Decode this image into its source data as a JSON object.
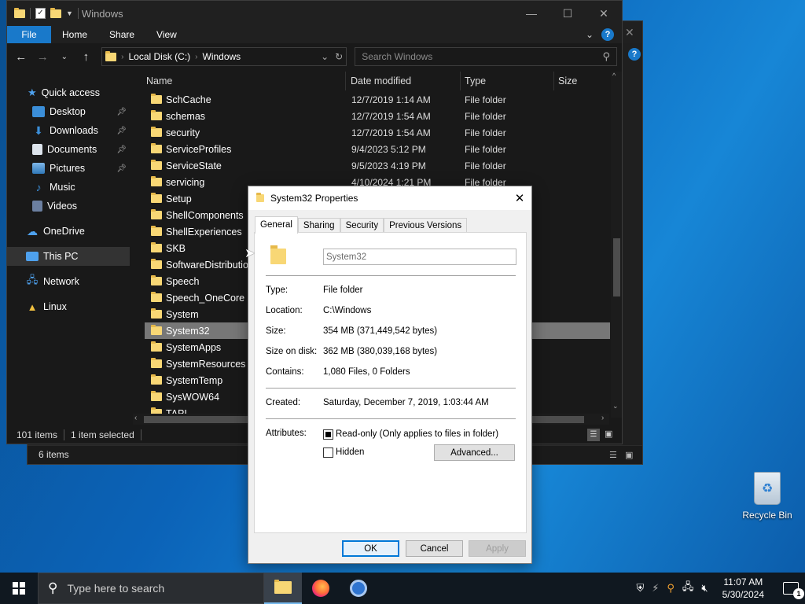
{
  "explorer": {
    "title": "Windows",
    "ribbon_tabs": [
      "File",
      "Home",
      "Share",
      "View"
    ],
    "address": {
      "drive": "Local Disk (C:)",
      "folder": "Windows"
    },
    "search_placeholder": "Search Windows",
    "columns": {
      "name": "Name",
      "date": "Date modified",
      "type": "Type",
      "size": "Size"
    },
    "nav": {
      "quick_access": "Quick access",
      "desktop": "Desktop",
      "downloads": "Downloads",
      "documents": "Documents",
      "pictures": "Pictures",
      "music": "Music",
      "videos": "Videos",
      "onedrive": "OneDrive",
      "thispc": "This PC",
      "network": "Network",
      "linux": "Linux"
    },
    "rows": [
      {
        "name": "SchCache",
        "date": "12/7/2019 1:14 AM",
        "type": "File folder"
      },
      {
        "name": "schemas",
        "date": "12/7/2019 1:54 AM",
        "type": "File folder"
      },
      {
        "name": "security",
        "date": "12/7/2019 1:54 AM",
        "type": "File folder"
      },
      {
        "name": "ServiceProfiles",
        "date": "9/4/2023 5:12 PM",
        "type": "File folder"
      },
      {
        "name": "ServiceState",
        "date": "9/5/2023 4:19 PM",
        "type": "File folder"
      },
      {
        "name": "servicing",
        "date": "4/10/2024 1:21 PM",
        "type": "File folder"
      },
      {
        "name": "Setup",
        "date": "",
        "type": ""
      },
      {
        "name": "ShellComponents",
        "date": "",
        "type": ""
      },
      {
        "name": "ShellExperiences",
        "date": "",
        "type": ""
      },
      {
        "name": "SKB",
        "date": "",
        "type": ""
      },
      {
        "name": "SoftwareDistribution",
        "date": "",
        "type": ""
      },
      {
        "name": "Speech",
        "date": "",
        "type": ""
      },
      {
        "name": "Speech_OneCore",
        "date": "",
        "type": ""
      },
      {
        "name": "System",
        "date": "",
        "type": ""
      },
      {
        "name": "System32",
        "date": "",
        "type": ""
      },
      {
        "name": "SystemApps",
        "date": "",
        "type": ""
      },
      {
        "name": "SystemResources",
        "date": "",
        "type": ""
      },
      {
        "name": "SystemTemp",
        "date": "",
        "type": ""
      },
      {
        "name": "SysWOW64",
        "date": "",
        "type": ""
      },
      {
        "name": "TAPI",
        "date": "",
        "type": ""
      }
    ],
    "status": {
      "items": "101 items",
      "selected": "1 item selected"
    }
  },
  "background_window": {
    "status_items": "6 items"
  },
  "properties": {
    "title": "System32 Properties",
    "tabs": [
      "General",
      "Sharing",
      "Security",
      "Previous Versions"
    ],
    "name_value": "System32",
    "fields": {
      "type_label": "Type:",
      "type_value": "File folder",
      "location_label": "Location:",
      "location_value": "C:\\Windows",
      "size_label": "Size:",
      "size_value": "354 MB (371,449,542 bytes)",
      "disk_label": "Size on disk:",
      "disk_value": "362 MB (380,039,168 bytes)",
      "contains_label": "Contains:",
      "contains_value": "1,080 Files, 0 Folders",
      "created_label": "Created:",
      "created_value": "Saturday, December 7, 2019, 1:03:44 AM",
      "attributes_label": "Attributes:"
    },
    "readonly_label": "Read-only (Only applies to files in folder)",
    "hidden_label": "Hidden",
    "advanced_label": "Advanced...",
    "ok_label": "OK",
    "cancel_label": "Cancel",
    "apply_label": "Apply"
  },
  "desktop": {
    "recycle_bin": "Recycle Bin"
  },
  "taskbar": {
    "search_placeholder": "Type here to search",
    "time": "11:07 AM",
    "date": "5/30/2024",
    "notification_count": "1"
  }
}
